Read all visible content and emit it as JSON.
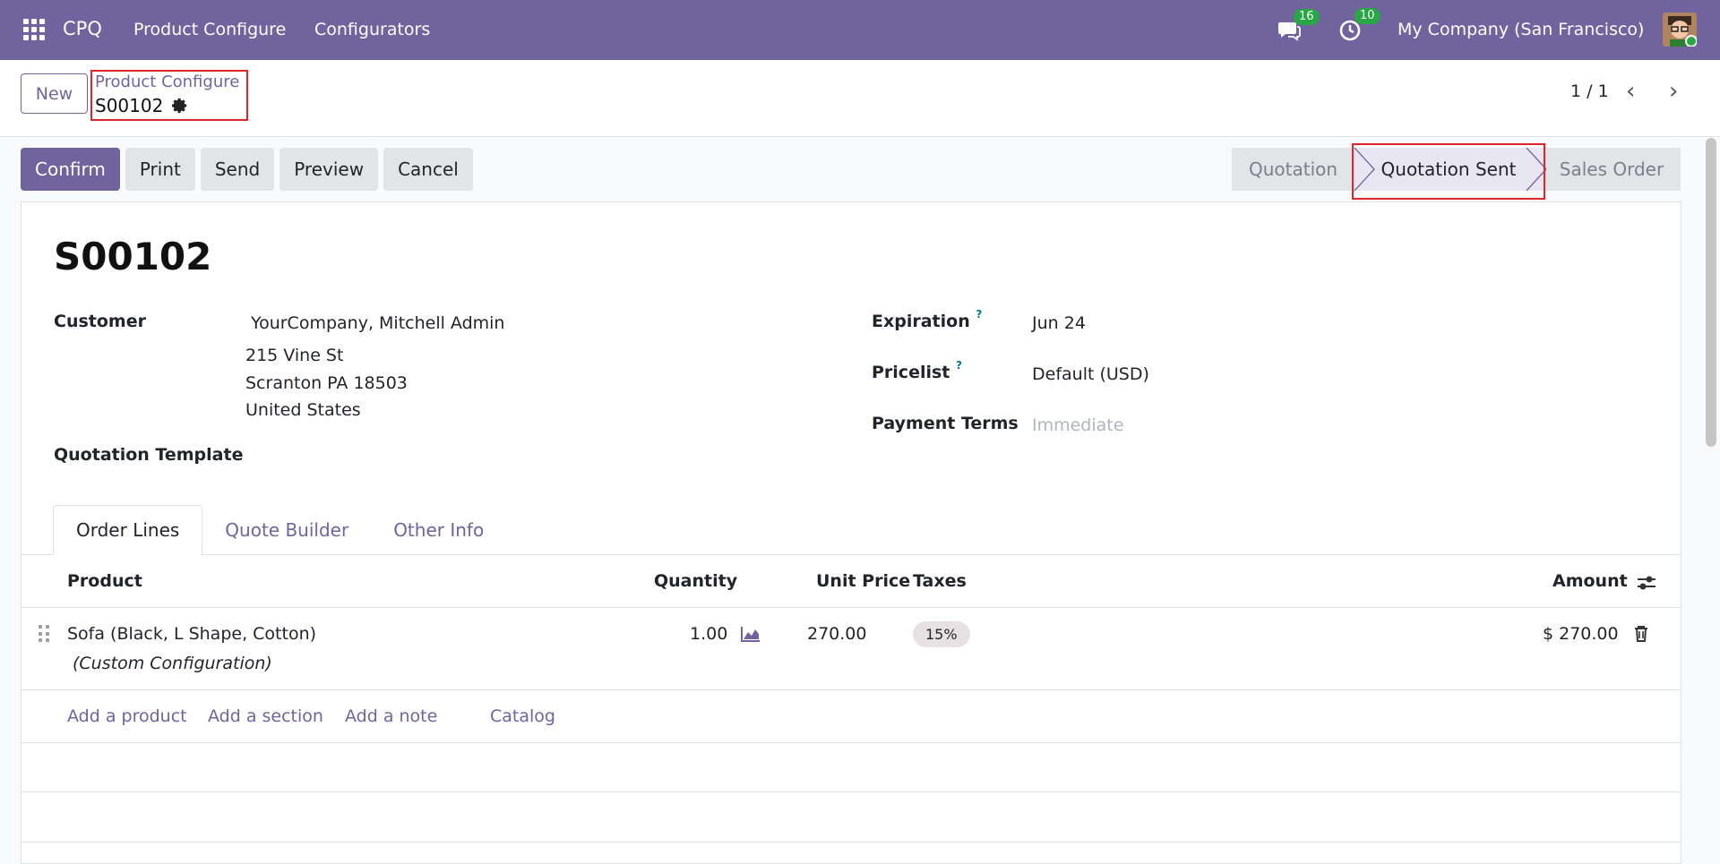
{
  "navbar": {
    "brand": "CPQ",
    "menu": [
      "Product Configure",
      "Configurators"
    ],
    "messages_count": "16",
    "activities_count": "10",
    "company": "My Company (San Francisco)"
  },
  "control": {
    "new_label": "New",
    "breadcrumb_parent": "Product Configure",
    "breadcrumb_current": "S00102",
    "pager": "1 / 1"
  },
  "actions": [
    "Confirm",
    "Print",
    "Send",
    "Preview",
    "Cancel"
  ],
  "status_stages": [
    "Quotation",
    "Quotation Sent",
    "Sales Order"
  ],
  "status_current": "Quotation Sent",
  "form": {
    "title": "S00102",
    "customer_label": "Customer",
    "customer_name": "YourCompany, Mitchell Admin",
    "address_line1": "215 Vine St",
    "address_line2": "Scranton PA 18503",
    "address_line3": "United States",
    "quotation_template_label": "Quotation Template",
    "expiration_label": "Expiration",
    "expiration_value": "Jun 24",
    "pricelist_label": "Pricelist",
    "pricelist_value": "Default (USD)",
    "payment_terms_label": "Payment Terms",
    "payment_terms_placeholder": "Immediate",
    "help_mark": "?"
  },
  "tabs": [
    "Order Lines",
    "Quote Builder",
    "Other Info"
  ],
  "table": {
    "headers": {
      "product": "Product",
      "quantity": "Quantity",
      "unit_price": "Unit Price",
      "taxes": "Taxes",
      "amount": "Amount"
    },
    "rows": [
      {
        "product": "Sofa (Black, L Shape, Cotton)",
        "description": "(Custom Configuration)",
        "quantity": "1.00",
        "unit_price": "270.00",
        "tax": "15%",
        "amount": "$ 270.00"
      }
    ],
    "add_links": [
      "Add a product",
      "Add a section",
      "Add a note",
      "Catalog"
    ]
  },
  "colors": {
    "brand": "#71639e",
    "highlight": "#e0242b",
    "badge": "#28a745"
  }
}
